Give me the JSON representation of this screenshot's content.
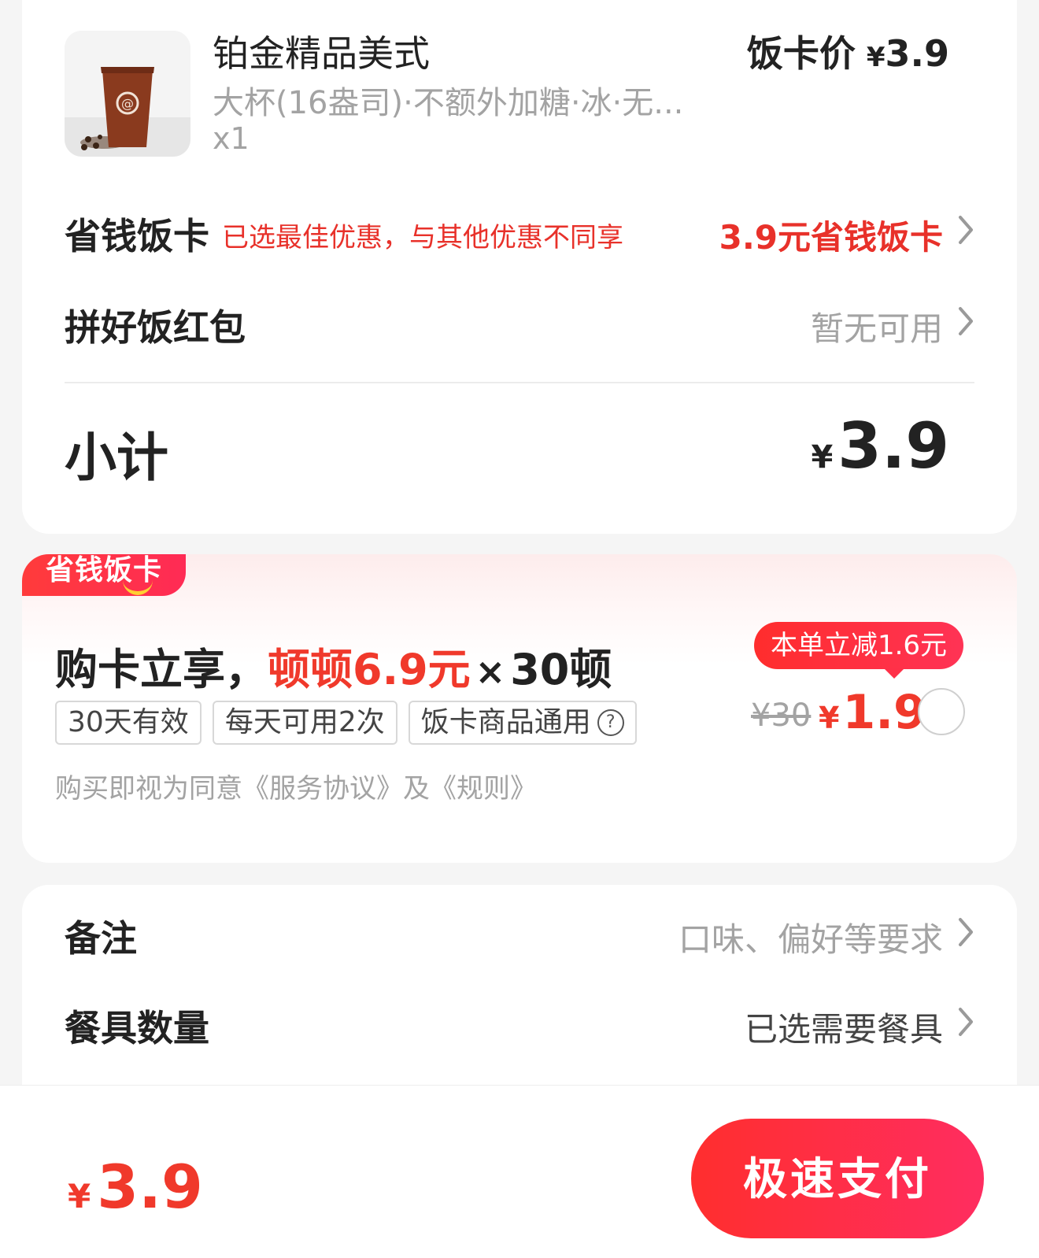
{
  "product": {
    "name": "铂金精品美式",
    "spec": "大杯(16盎司)·不额外加糖·冰·无...",
    "qty": "x1",
    "price_label": "饭卡价",
    "price_yen": "¥",
    "price_value": "3.9"
  },
  "savings_card_row": {
    "title": "省钱饭卡",
    "note": "已选最佳优惠，与其他优惠不同享",
    "value": "3.9元省钱饭卡"
  },
  "red_packet_row": {
    "title": "拼好饭红包",
    "value": "暂无可用"
  },
  "subtotal": {
    "label": "小计",
    "yen": "¥",
    "value": "3.9"
  },
  "promo": {
    "tag": "省钱饭卡",
    "title_prefix": "购卡立享，",
    "title_highlight": "顿顿6.9元",
    "title_times": "×",
    "title_suffix": "30顿",
    "badges": [
      "30天有效",
      "每天可用2次",
      "饭卡商品通用"
    ],
    "badge_help": "?",
    "agreement": "购买即视为同意《服务协议》及《规则》",
    "bubble": "本单立减1.6元",
    "old_price": "¥30",
    "new_price_yen": "¥",
    "new_price": "1.9"
  },
  "remark_row": {
    "title": "备注",
    "placeholder": "口味、偏好等要求"
  },
  "utensils_row": {
    "title": "餐具数量",
    "value": "已选需要餐具"
  },
  "bottom_bar": {
    "total_yen": "¥",
    "total": "3.9",
    "pay_button": "极速支付"
  },
  "colors": {
    "accent_red": "#f0392b",
    "button_gradient_start": "#ff2e2e",
    "button_gradient_end": "#ff2d60"
  },
  "icons": [
    "coffee-cup-image",
    "chevron-right-icon",
    "help-circle-icon",
    "radio-unchecked-icon"
  ]
}
